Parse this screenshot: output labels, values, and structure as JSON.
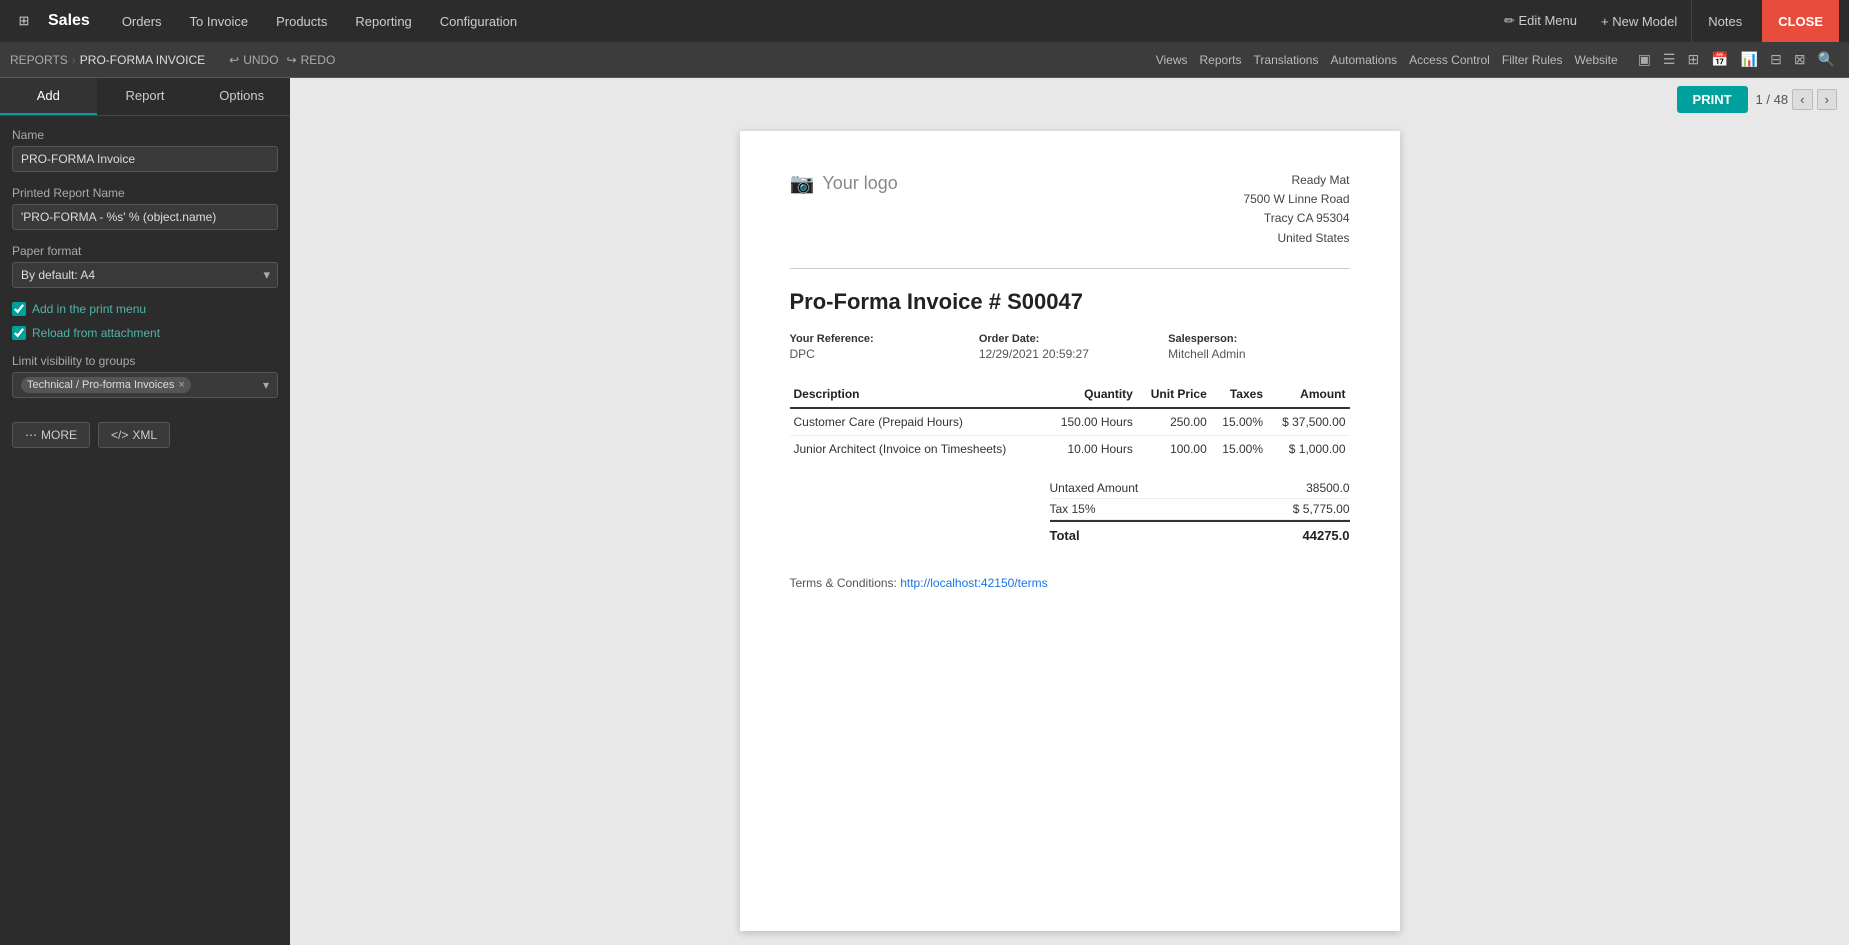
{
  "app": {
    "name": "Sales",
    "close_label": "CLOSE",
    "notes_label": "Notes"
  },
  "top_nav": {
    "items": [
      {
        "label": "Orders"
      },
      {
        "label": "To Invoice"
      },
      {
        "label": "Products"
      },
      {
        "label": "Reporting"
      },
      {
        "label": "Configuration"
      }
    ],
    "edit_menu": "✏ Edit Menu",
    "new_model": "+ New Model"
  },
  "sub_nav": {
    "breadcrumb_reports": "REPORTS",
    "breadcrumb_current": "PRO-FORMA INVOICE",
    "undo_label": "UNDO",
    "redo_label": "REDO",
    "right_items": [
      "Views",
      "Reports",
      "Translations",
      "Automations",
      "Access Control",
      "Filter Rules",
      "Website"
    ]
  },
  "sidebar": {
    "tabs": [
      {
        "label": "Add",
        "active": true
      },
      {
        "label": "Report",
        "active": false
      },
      {
        "label": "Options",
        "active": false
      }
    ],
    "name_label": "Name",
    "name_value": "PRO-FORMA Invoice",
    "printed_report_name_label": "Printed Report Name",
    "printed_report_name_value": "'PRO-FORMA - %s' % (object.name)",
    "paper_format_label": "Paper format",
    "paper_format_value": "By default: A4",
    "add_in_print_menu_label": "Add in the print menu",
    "add_in_print_menu_checked": true,
    "reload_from_attachment_label": "Reload from attachment",
    "reload_from_attachment_checked": true,
    "limit_visibility_label": "Limit visibility to groups",
    "tag_label": "Technical / Pro-forma Invoices",
    "more_btn": "MORE",
    "xml_btn": "XML"
  },
  "toolbar": {
    "print_label": "PRINT",
    "page_current": "1",
    "page_total": "48"
  },
  "document": {
    "logo_placeholder": "Your logo",
    "company_name": "Ready Mat",
    "company_address1": "7500 W Linne Road",
    "company_address2": "Tracy CA 95304",
    "company_country": "United States",
    "invoice_title": "Pro-Forma Invoice # S00047",
    "ref_label": "Your Reference:",
    "ref_value": "DPC",
    "order_date_label": "Order Date:",
    "order_date_value": "12/29/2021 20:59:27",
    "salesperson_label": "Salesperson:",
    "salesperson_value": "Mitchell Admin",
    "table_headers": {
      "description": "Description",
      "quantity": "Quantity",
      "unit_price": "Unit Price",
      "taxes": "Taxes",
      "amount": "Amount"
    },
    "line_items": [
      {
        "description": "Customer Care (Prepaid Hours)",
        "quantity": "150.00 Hours",
        "unit_price": "250.00",
        "taxes": "15.00%",
        "amount": "$ 37,500.00"
      },
      {
        "description": "Junior Architect (Invoice on Timesheets)",
        "quantity": "10.00 Hours",
        "unit_price": "100.00",
        "taxes": "15.00%",
        "amount": "$ 1,000.00"
      }
    ],
    "untaxed_label": "Untaxed Amount",
    "untaxed_value": "38500.0",
    "tax_label": "Tax 15%",
    "tax_value": "$ 5,775.00",
    "total_label": "Total",
    "total_value": "44275.0",
    "terms_label": "Terms & Conditions:",
    "terms_link": "http://localhost:42150/terms"
  }
}
